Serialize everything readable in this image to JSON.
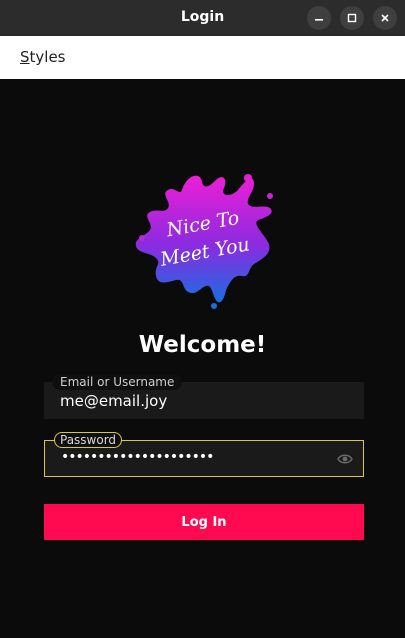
{
  "window": {
    "title": "Login",
    "controls": [
      "minimize-icon",
      "maximize-icon",
      "close-icon"
    ]
  },
  "menubar": {
    "items": [
      {
        "mnemonic": "S",
        "rest": "tyles"
      }
    ]
  },
  "logo": {
    "text_line1": "Nice To",
    "text_line2": "Meet You",
    "gradient": [
      "#e81ed8",
      "#1e6ee0"
    ]
  },
  "welcome": {
    "heading": "Welcome!"
  },
  "email": {
    "label": "Email or Username",
    "value": "me@email.joy"
  },
  "password": {
    "label": "Password",
    "masked_value": "•••••••••••••••••••••",
    "toggle_icon": "eye-icon"
  },
  "login": {
    "button_label": "Log In"
  },
  "colors": {
    "accent": "#ff0a50",
    "focus_border": "#d8c83a",
    "background": "#0b0b0b"
  }
}
